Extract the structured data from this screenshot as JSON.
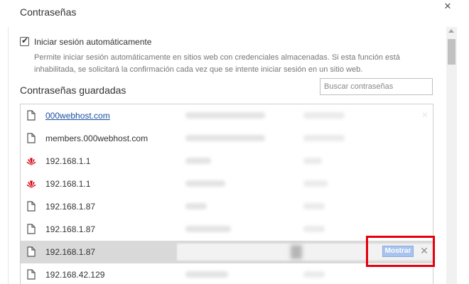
{
  "dialog": {
    "title": "Contraseñas",
    "close_glyph": "✕",
    "close_icon": "close-icon"
  },
  "auto_signin": {
    "checked": true,
    "label": "Iniciar sesión automáticamente",
    "description": "Permite iniciar sesión automáticamente en sitios web con credenciales almacenadas. Si esta función está inhabilitada, se solicitará la confirmación cada vez que se intente iniciar sesión en un sitio web."
  },
  "saved_passwords": {
    "title": "Contraseñas guardadas",
    "search_placeholder": "Buscar contraseñas",
    "show_button": "Mostrar",
    "remove_glyph": "✕",
    "rows": [
      {
        "site": "000webhost.com",
        "icon": "page-icon",
        "link": true
      },
      {
        "site": "members.000webhost.com",
        "icon": "page-icon",
        "link": false
      },
      {
        "site": "192.168.1.1",
        "icon": "huawei-logo-icon",
        "link": false
      },
      {
        "site": "192.168.1.1",
        "icon": "huawei-logo-icon",
        "link": false
      },
      {
        "site": "192.168.1.87",
        "icon": "page-icon",
        "link": false
      },
      {
        "site": "192.168.1.87",
        "icon": "page-icon",
        "link": false
      },
      {
        "site": "192.168.1.87",
        "icon": "page-icon",
        "link": false,
        "selected": true
      },
      {
        "site": "192.168.42.129",
        "icon": "page-icon",
        "link": false
      }
    ]
  },
  "colors": {
    "accent_highlight": "#e3000f",
    "link": "#1a4fa0",
    "show_button_bg": "#a8c4ee",
    "huawei_red": "#d7000f"
  }
}
